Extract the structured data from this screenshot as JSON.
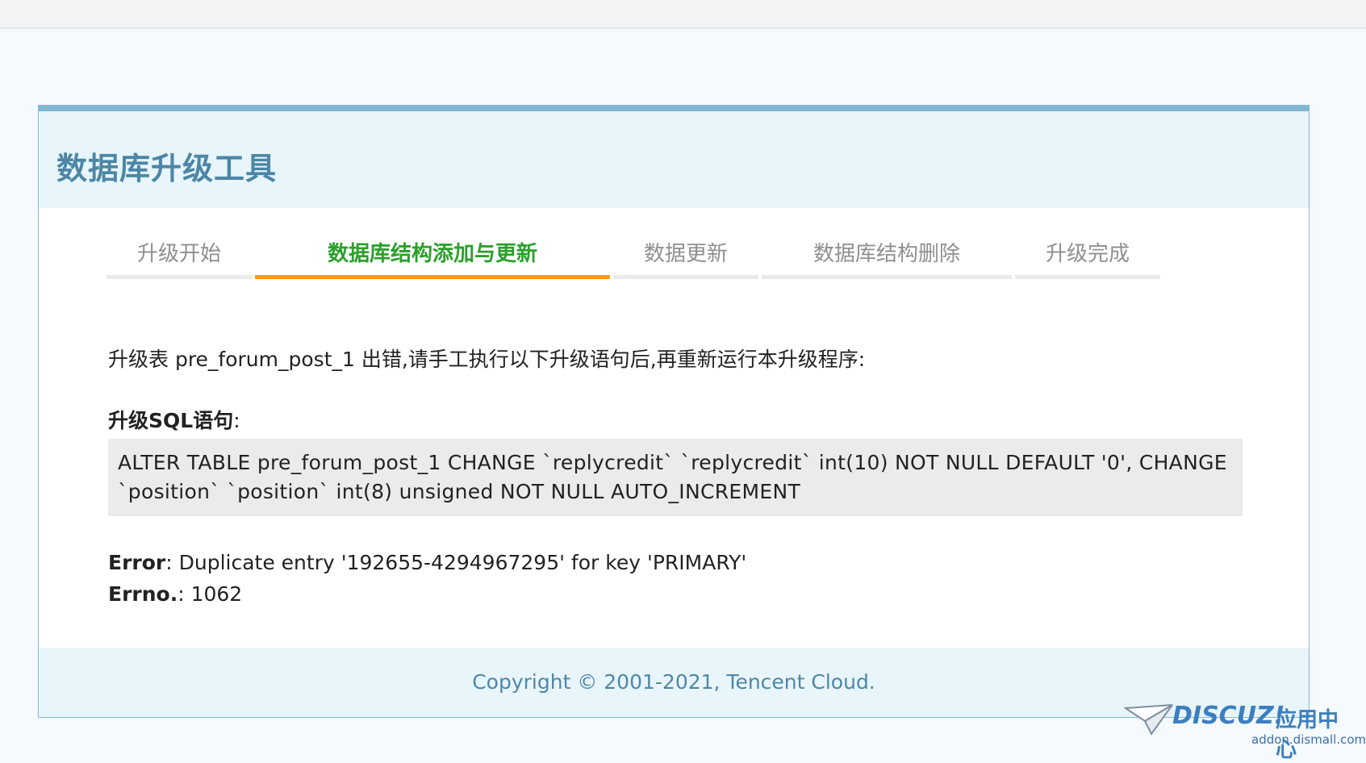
{
  "title": "数据库升级工具",
  "steps": [
    {
      "label": "升级开始",
      "active": false
    },
    {
      "label": "数据库结构添加与更新",
      "active": true
    },
    {
      "label": "数据更新",
      "active": false
    },
    {
      "label": "数据库结构删除",
      "active": false
    },
    {
      "label": "升级完成",
      "active": false
    }
  ],
  "message": "升级表 pre_forum_post_1 出错,请手工执行以下升级语句后,再重新运行本升级程序:",
  "sql": {
    "heading": "升级SQL语句",
    "colon": ":",
    "statement": "ALTER TABLE pre_forum_post_1 CHANGE `replycredit` `replycredit` int(10) NOT NULL DEFAULT '0', CHANGE `position` `position` int(8) unsigned NOT NULL AUTO_INCREMENT"
  },
  "error": {
    "label": "Error",
    "text": ": Duplicate entry '192655-4294967295' for key 'PRIMARY'",
    "errno_label": "Errno.",
    "errno_text": ": 1062"
  },
  "footer": "Copyright © 2001-2021, Tencent Cloud.",
  "watermark": {
    "logo": "DISCUZ!",
    "cn": "应用中心",
    "sub": "addon.dismall.com"
  },
  "colors": {
    "accent": "#82b6d3",
    "active_step": "#2aa02a",
    "active_bar": "#f79a1e",
    "title": "#4c86a6"
  }
}
